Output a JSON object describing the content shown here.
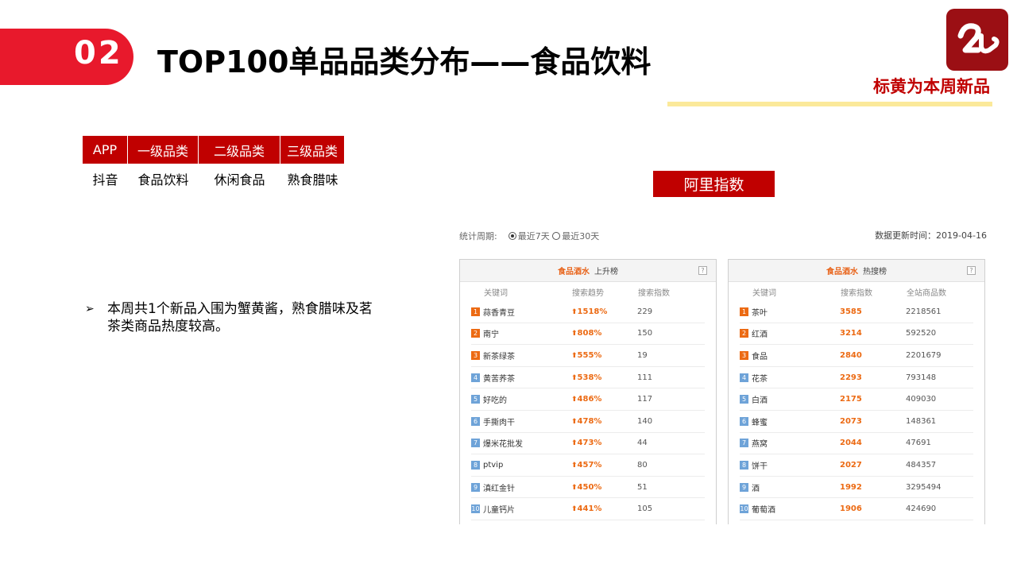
{
  "header": {
    "number": "02",
    "title": "TOP100单品品类分布——食品饮料",
    "subtitle": "标黄为本周新品",
    "colors": {
      "accent": "#e8192c",
      "dark_red": "#c00000",
      "logo_bg": "#9b0f14",
      "highlight_line": "#fbe99a"
    }
  },
  "category_table": {
    "headers": [
      "APP",
      "一级品类",
      "二级品类",
      "三级品类"
    ],
    "values": [
      "抖音",
      "食品饮料",
      "休闲食品",
      "熟食腊味"
    ]
  },
  "ali_label": "阿里指数",
  "bullet": {
    "mark": "➢",
    "text": "本周共1个新品入围为蟹黄酱，熟食腊味及茗茶类商品热度较高。"
  },
  "stats": {
    "period_label": "统计周期:",
    "options": [
      "最近7天",
      "最近30天"
    ],
    "selected_option": "最近7天",
    "updated": "数据更新时间：2019-04-16"
  },
  "rising_panel": {
    "category": "食品酒水",
    "name": "上升榜",
    "help": "?",
    "columns": [
      "关键词",
      "搜索趋势",
      "搜索指数"
    ],
    "rows": [
      {
        "rank": "1",
        "keyword": "蒜香青豆",
        "trend": "1518%",
        "index": "229"
      },
      {
        "rank": "2",
        "keyword": "南宁",
        "trend": "808%",
        "index": "150"
      },
      {
        "rank": "3",
        "keyword": "新茶绿茶",
        "trend": "555%",
        "index": "19"
      },
      {
        "rank": "4",
        "keyword": "黄苦荞茶",
        "trend": "538%",
        "index": "111"
      },
      {
        "rank": "5",
        "keyword": "好吃的",
        "trend": "486%",
        "index": "117"
      },
      {
        "rank": "6",
        "keyword": "手撕肉干",
        "trend": "478%",
        "index": "140"
      },
      {
        "rank": "7",
        "keyword": "爆米花批发",
        "trend": "473%",
        "index": "44"
      },
      {
        "rank": "8",
        "keyword": "ptvip",
        "trend": "457%",
        "index": "80"
      },
      {
        "rank": "9",
        "keyword": "滇红金针",
        "trend": "450%",
        "index": "51"
      },
      {
        "rank": "10",
        "keyword": "儿童钙片",
        "trend": "441%",
        "index": "105"
      }
    ]
  },
  "hot_panel": {
    "category": "食品酒水",
    "name": "热搜榜",
    "help": "?",
    "columns": [
      "关键词",
      "搜索指数",
      "全站商品数"
    ],
    "rows": [
      {
        "rank": "1",
        "keyword": "茶叶",
        "index": "3585",
        "count": "2218561"
      },
      {
        "rank": "2",
        "keyword": "红酒",
        "index": "3214",
        "count": "592520"
      },
      {
        "rank": "3",
        "keyword": "食品",
        "index": "2840",
        "count": "2201679"
      },
      {
        "rank": "4",
        "keyword": "花茶",
        "index": "2293",
        "count": "793148"
      },
      {
        "rank": "5",
        "keyword": "白酒",
        "index": "2175",
        "count": "409030"
      },
      {
        "rank": "6",
        "keyword": "蜂蜜",
        "index": "2073",
        "count": "148361"
      },
      {
        "rank": "7",
        "keyword": "燕窝",
        "index": "2044",
        "count": "47691"
      },
      {
        "rank": "8",
        "keyword": "饼干",
        "index": "2027",
        "count": "484357"
      },
      {
        "rank": "9",
        "keyword": "酒",
        "index": "1992",
        "count": "3295494"
      },
      {
        "rank": "10",
        "keyword": "葡萄酒",
        "index": "1906",
        "count": "424690"
      }
    ]
  },
  "icons": {
    "logo": "brand-logo-icon",
    "trend_arrow": "up-arrow-icon",
    "help": "help-icon"
  }
}
